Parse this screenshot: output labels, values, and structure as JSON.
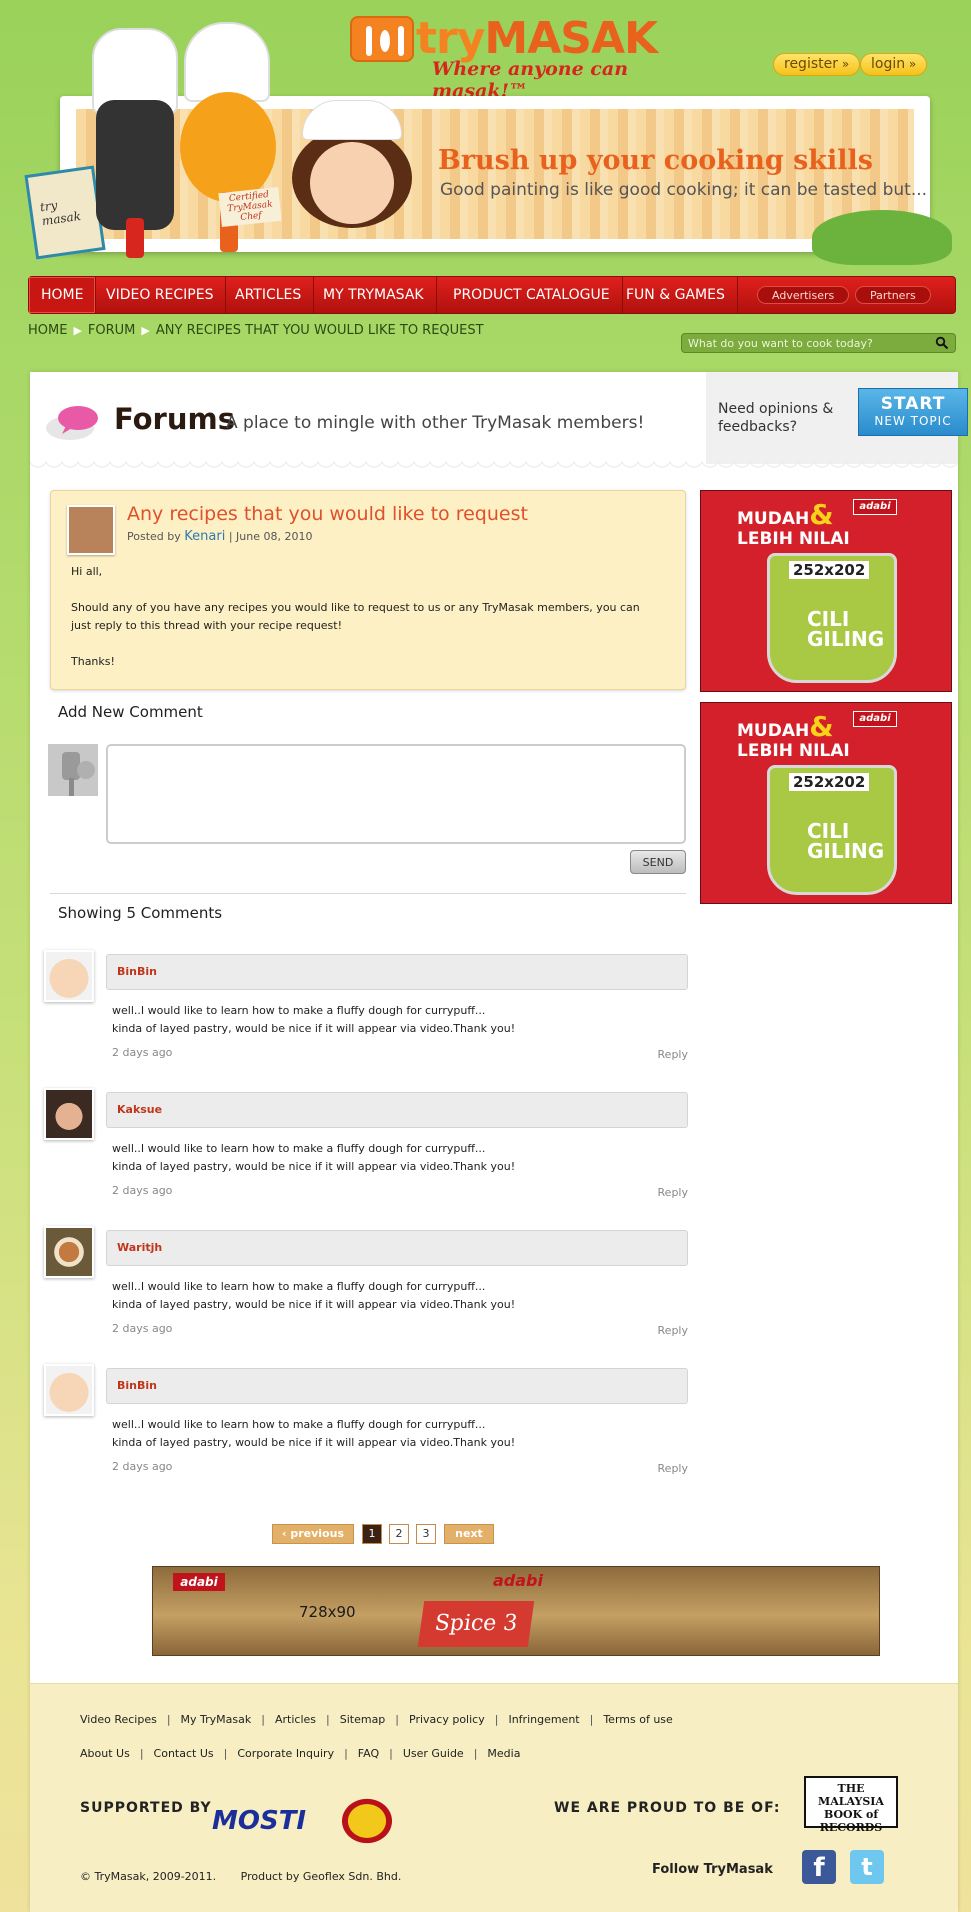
{
  "brand": {
    "name_prefix": "try",
    "name_main": "MASAK",
    "tagline": "Where anyone can masak!™"
  },
  "auth": {
    "register": "register",
    "login": "login"
  },
  "banner": {
    "title": "Brush up your cooking skills",
    "subtitle": "Good painting is like good cooking; it can be tasted but...",
    "book_text": "try masak",
    "badge_text": "Certified TryMasak Chef"
  },
  "nav": {
    "items": [
      "HOME",
      "VIDEO RECIPES",
      "ARTICLES",
      "MY TRYMASAK",
      "PRODUCT CATALOGUE",
      "FUN & GAMES"
    ],
    "pills": [
      "Advertisers",
      "Partners"
    ]
  },
  "breadcrumb": [
    "HOME",
    "FORUM",
    "ANY RECIPES THAT YOU WOULD LIKE TO REQUEST"
  ],
  "search": {
    "placeholder": "What do you want to cook today?"
  },
  "forum": {
    "title": "Forums",
    "subtitle": "A place to mingle with other TryMasak members!",
    "cta_question_1": "Need opinions &",
    "cta_question_2": "feedbacks?",
    "cta_line1": "START",
    "cta_line2": "NEW TOPIC"
  },
  "post": {
    "title": "Any recipes that you would like to request",
    "posted_by": "Posted by",
    "author": "Kenari",
    "date": "| June 08, 2010",
    "greeting": "Hi all,",
    "body": "Should any of you have any recipes you would like to request to us or any TryMasak members, you can just reply to this thread with your recipe request!",
    "signoff": "Thanks!"
  },
  "add_comment": {
    "title": "Add New Comment",
    "send": "SEND"
  },
  "comments_header": "Showing 5 Comments",
  "comments": [
    {
      "name": "BinBin",
      "line1": "well..I would like to learn how to make a fluffy dough for currypuff...",
      "line2": "kinda of layed pastry, would be nice if it will appear via video.Thank you!",
      "time": "2 days ago",
      "reply": "Reply"
    },
    {
      "name": "Kaksue",
      "line1": "well..I would like to learn how to make a fluffy dough for currypuff...",
      "line2": "kinda of layed pastry, would be nice if it will appear via video.Thank you!",
      "time": "2 days ago",
      "reply": "Reply"
    },
    {
      "name": "Waritjh",
      "line1": "well..I would like to learn how to make a fluffy dough for currypuff...",
      "line2": "kinda of layed pastry, would be nice if it will appear via video.Thank you!",
      "time": "2 days ago",
      "reply": "Reply"
    },
    {
      "name": "BinBin",
      "line1": "well..I would like to learn how to make a fluffy dough for currypuff...",
      "line2": "kinda of layed pastry, would be nice if it will appear via video.Thank you!",
      "time": "2 days ago",
      "reply": "Reply"
    }
  ],
  "pagination": {
    "previous": "previous",
    "pages": [
      "1",
      "2",
      "3"
    ],
    "current": "1",
    "next": "next"
  },
  "ads": {
    "side_headline_1": "MUDAH",
    "side_amp": "&",
    "side_headline_2": "LEBIH NILAI",
    "side_brand": "adabi",
    "side_size": "252x202",
    "side_product_1": "CILI",
    "side_product_2": "GILING",
    "wide_size": "728x90",
    "wide_brand": "adabi",
    "wide_promo_1": "Spice",
    "wide_promo_2": "3"
  },
  "footer": {
    "links_row1": [
      "Video Recipes",
      "My TryMasak",
      "Articles",
      "Sitemap",
      "Privacy policy",
      "Infringement",
      "Terms of use"
    ],
    "links_row2": [
      "About Us",
      "Contact Us",
      "Corporate Inquiry",
      "FAQ",
      "User Guide",
      "Media"
    ],
    "supported_by": "SUPPORTED BY",
    "mosti": "MOSTI",
    "proud": "WE ARE PROUD TO BE OF:",
    "mbr": "THE MALAYSIA BOOK of RECORDS",
    "copyright": "© TryMasak, 2009-2011.",
    "product_by": "Product by Geoflex Sdn. Bhd.",
    "follow": "Follow TryMasak",
    "facebook": "f",
    "twitter": "t"
  },
  "colors": {
    "accent_red": "#d6261e",
    "brand_orange": "#f58220",
    "link_blue": "#2d7ab0",
    "bg_green": "#9ad25a"
  }
}
